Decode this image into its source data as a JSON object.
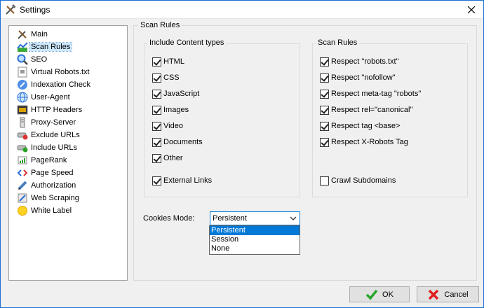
{
  "window": {
    "title": "Settings"
  },
  "sidebar": {
    "items": [
      {
        "label": "Main",
        "icon": "tools-icon"
      },
      {
        "label": "Scan Rules",
        "icon": "chart-icon",
        "selected": true
      },
      {
        "label": "SEO",
        "icon": "magnifier-icon"
      },
      {
        "label": "Virtual Robots.txt",
        "icon": "robot-file-icon"
      },
      {
        "label": "Indexation Check",
        "icon": "indexation-icon"
      },
      {
        "label": "User-Agent",
        "icon": "globe-icon"
      },
      {
        "label": "HTTP Headers",
        "icon": "terminal-icon"
      },
      {
        "label": "Proxy-Server",
        "icon": "server-icon"
      },
      {
        "label": "Exclude URLs",
        "icon": "exclude-icon"
      },
      {
        "label": "Include URLs",
        "icon": "include-icon"
      },
      {
        "label": "PageRank",
        "icon": "pagerank-icon"
      },
      {
        "label": "Page Speed",
        "icon": "code-icon"
      },
      {
        "label": "Authorization",
        "icon": "pen-icon"
      },
      {
        "label": "Web Scraping",
        "icon": "scraping-icon"
      },
      {
        "label": "White Label",
        "icon": "sun-icon"
      }
    ]
  },
  "main": {
    "group_title": "Scan Rules",
    "content_types": {
      "title": "Include Content types",
      "items": [
        {
          "label": "HTML",
          "checked": true
        },
        {
          "label": "CSS",
          "checked": true
        },
        {
          "label": "JavaScript",
          "checked": true
        },
        {
          "label": "Images",
          "checked": true
        },
        {
          "label": "Video",
          "checked": true
        },
        {
          "label": "Documents",
          "checked": true
        },
        {
          "label": "Other",
          "checked": true
        },
        {
          "label": "External Links",
          "checked": true
        }
      ]
    },
    "scan_rules": {
      "title": "Scan Rules",
      "items": [
        {
          "label": "Respect \"robots.txt\"",
          "checked": true
        },
        {
          "label": "Respect \"nofollow\"",
          "checked": true
        },
        {
          "label": "Respect meta-tag \"robots\"",
          "checked": true
        },
        {
          "label": "Respect rel=\"canonical\"",
          "checked": true
        },
        {
          "label": "Respect tag <base>",
          "checked": true
        },
        {
          "label": "Respect X-Robots Tag",
          "checked": true
        },
        {
          "label": "Crawl Subdomains",
          "checked": false
        }
      ]
    },
    "cookies": {
      "label": "Cookies Mode:",
      "value": "Persistent",
      "options": [
        "Persistent",
        "Session",
        "None"
      ],
      "highlighted": "Persistent"
    }
  },
  "buttons": {
    "ok": "OK",
    "cancel": "Cancel"
  },
  "colors": {
    "accent": "#0078d7",
    "selection": "#cce8ff",
    "ok_icon": "#2aa52a",
    "cancel_icon": "#e02020"
  }
}
